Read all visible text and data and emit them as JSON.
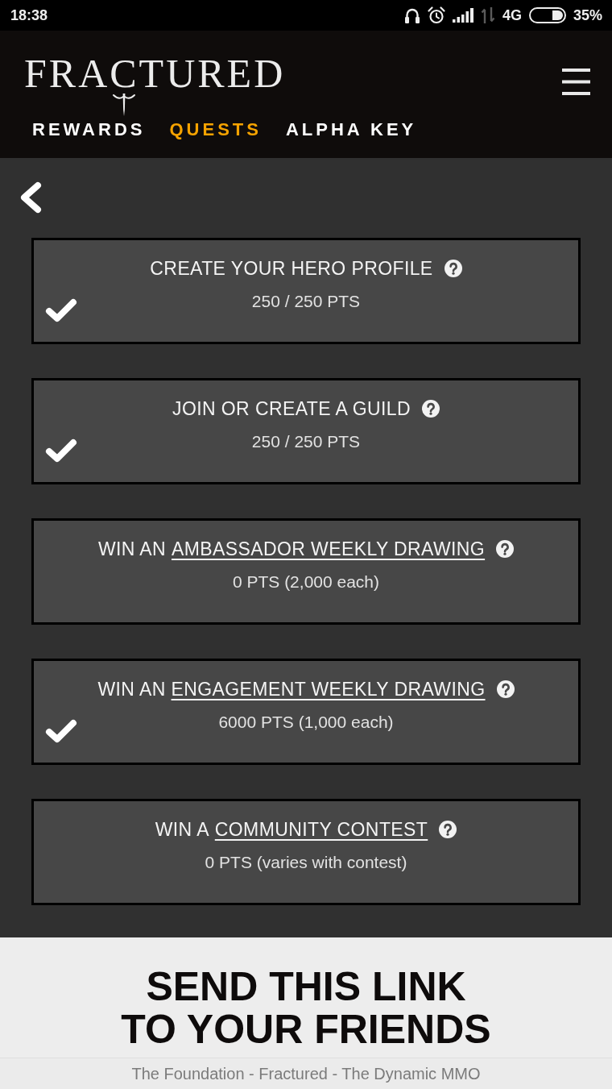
{
  "status_bar": {
    "time": "18:38",
    "network": "4G",
    "battery": "35%"
  },
  "header": {
    "logo": "FRACTURED",
    "nav": [
      {
        "label": "REWARDS",
        "selected": false
      },
      {
        "label": "QUESTS",
        "selected": true
      },
      {
        "label": "ALPHA KEY",
        "selected": false
      }
    ]
  },
  "quests": [
    {
      "title": "CREATE YOUR HERO PROFILE",
      "points": "250 / 250 PTS",
      "completed": true
    },
    {
      "title": "JOIN OR CREATE A GUILD",
      "points": "250 / 250 PTS",
      "completed": true
    },
    {
      "title": "WIN AN",
      "link": "AMBASSADOR WEEKLY DRAWING",
      "points": "0 PTS (2,000 each)",
      "completed": false
    },
    {
      "title": "WIN AN",
      "link": "ENGAGEMENT WEEKLY DRAWING",
      "points": "6000 PTS (1,000 each)",
      "completed": true
    },
    {
      "title": "WIN A",
      "link": "COMMUNITY CONTEST",
      "points": "0 PTS (varies with contest)",
      "completed": false
    }
  ],
  "share": {
    "heading": "SEND THIS LINK TO YOUR FRIENDS"
  },
  "browser_bar": {
    "title": "The Foundation - Fractured - The Dynamic MMO"
  }
}
